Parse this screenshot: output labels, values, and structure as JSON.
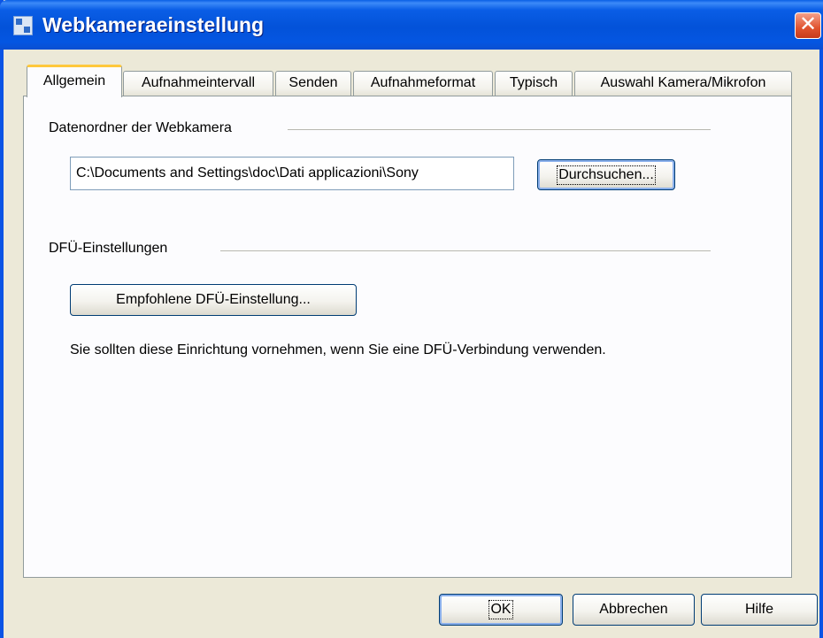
{
  "window": {
    "title": "Webkameraeinstellung",
    "close_glyph": "✕"
  },
  "tabs": [
    {
      "label": "Allgemein",
      "active": true
    },
    {
      "label": "Aufnahmeintervall",
      "active": false
    },
    {
      "label": "Senden",
      "active": false
    },
    {
      "label": "Aufnahmeformat",
      "active": false
    },
    {
      "label": "Typisch",
      "active": false
    },
    {
      "label": "Auswahl Kamera/Mikrofon",
      "active": false
    }
  ],
  "folder_group": {
    "label": "Datenordner der Webkamera",
    "path_value": "C:\\Documents and Settings\\doc\\Dati applicazioni\\Sony",
    "browse_label": "Durchsuchen..."
  },
  "dialup_group": {
    "label": "DFÜ-Einstellungen",
    "recommend_label": "Empfohlene DFÜ-Einstellung...",
    "info_text": "Sie sollten diese Einrichtung vornehmen, wenn Sie eine DFÜ-Verbindung verwenden."
  },
  "footer": {
    "ok_label": "OK",
    "cancel_label": "Abbrechen",
    "help_label": "Hilfe"
  },
  "colors": {
    "titlebar": "#0352d9",
    "face": "#ece9d8",
    "tab_highlight": "#ffc83c"
  }
}
